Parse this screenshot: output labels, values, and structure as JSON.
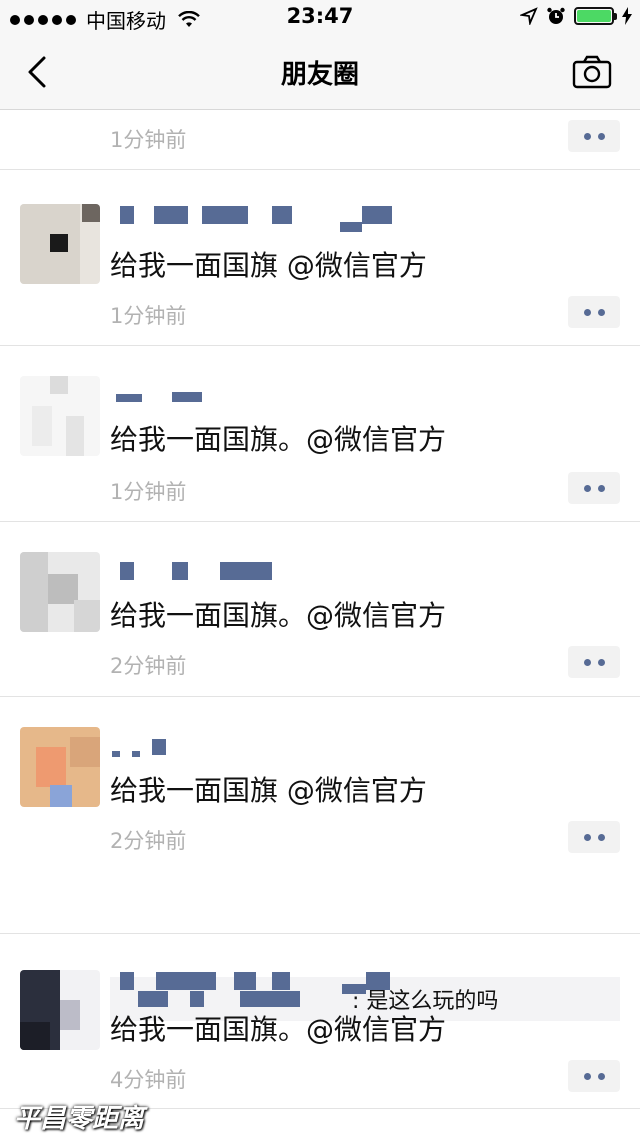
{
  "status_bar": {
    "carrier": "中国移动",
    "time": "23:47",
    "signal_icon": "signal-dots-icon",
    "wifi_icon": "wifi-icon",
    "location_icon": "location-arrow-icon",
    "alarm_icon": "alarm-icon",
    "battery_icon": "battery-icon",
    "charging_icon": "charging-icon",
    "battery_color": "#4cd964"
  },
  "nav": {
    "title": "朋友圈",
    "back_icon": "chevron-left-icon",
    "camera_icon": "camera-icon"
  },
  "colors": {
    "link_blue": "#576b95",
    "time_gray": "#b2b2b2",
    "bar_bg": "#f7f7f7"
  },
  "posts": [
    {
      "content": "",
      "time": "1分钟前"
    },
    {
      "content": "给我一面国旗 @微信官方",
      "time": "1分钟前"
    },
    {
      "content": "给我一面国旗。@微信官方",
      "time": "1分钟前"
    },
    {
      "content": "给我一面国旗。@微信官方",
      "time": "2分钟前"
    },
    {
      "content": "给我一面国旗 @微信官方",
      "time": "2分钟前",
      "comment": {
        "text": ": 是这么玩的吗"
      }
    },
    {
      "content": "给我一面国旗。@微信官方",
      "time": "4分钟前"
    }
  ],
  "more_icon": "more-dots-icon",
  "watermark": "平昌零距离"
}
